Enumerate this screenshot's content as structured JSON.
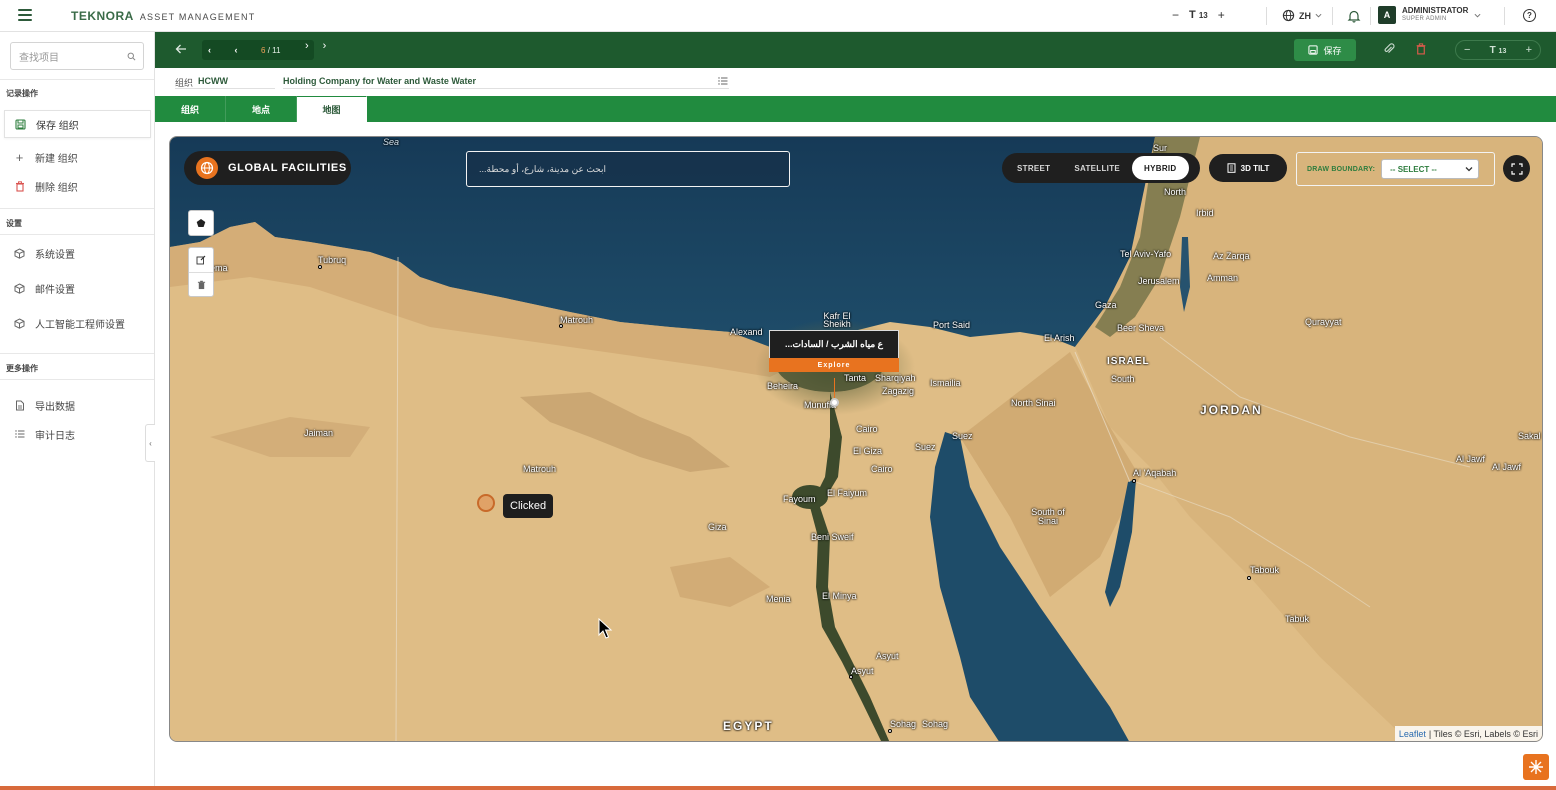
{
  "app": {
    "brand_name": "TEKNORA",
    "brand_sub": "ASSET MANAGEMENT"
  },
  "topbar": {
    "font_minus": "−",
    "font_size_label": "T",
    "font_size_value": "13",
    "font_plus": "+",
    "language": "ZH",
    "user_initial": "A",
    "user_name": "ADMINISTRATOR",
    "user_role": "SUPER ADMIN",
    "help": "?"
  },
  "sidebar": {
    "search_placeholder": "查找项目",
    "section_record": "记录操作",
    "save_org": "保存 组织",
    "new_org": "新建 组织",
    "delete_org": "删除 组织",
    "section_settings": "设置",
    "system_settings": "系统设置",
    "mail_settings": "邮件设置",
    "ai_settings": "人工智能工程师设置",
    "section_more": "更多操作",
    "export_data": "导出数据",
    "audit_log": "审计日志"
  },
  "toolbar": {
    "pager_current": "6",
    "pager_total": "/ 11",
    "save_label": "保存",
    "zoom_minus": "−",
    "zoom_t": "T",
    "zoom_value": "13",
    "zoom_plus": "+"
  },
  "org": {
    "label": "组织",
    "code": "HCWW",
    "name": "Holding Company for Water and Waste Water"
  },
  "tabs": [
    {
      "label": "组织"
    },
    {
      "label": "地点"
    },
    {
      "label": "地图"
    }
  ],
  "map": {
    "title": "GLOBAL FACILITIES",
    "search_placeholder": "...ابحث عن مدينة، شارع، أو محطة",
    "layers": [
      "STREET",
      "SATELLITE",
      "HYBRID"
    ],
    "active_layer": "HYBRID",
    "tilt_label": "3D TILT",
    "draw_label": "DRAW BOUNDARY:",
    "draw_select": "-- SELECT --",
    "popup_title": "...ع مياه الشرب / السادات",
    "popup_button": "Explore",
    "clicked_tooltip": "Clicked",
    "attribution_leaflet": "Leaflet",
    "attribution_rest": "| Tiles © Esri, Labels © Esri",
    "labels": {
      "sea": "Sea",
      "sur": "Sur",
      "north": "North",
      "irbid": "Irbid",
      "ema": "ema",
      "tubruq": "Tubruq",
      "telaviv": "Tel Aviv-Yafo",
      "azzarqa": "Az Zarqa",
      "jerusalem": "Jerusalem",
      "amman": "Amman",
      "matrouh1": "Matrouh",
      "kafr": "Kafr El Sheikh",
      "alexand": "Alexand",
      "portsaid": "Port Said",
      "gaza": "Gaza",
      "beersheva": "Beer Sheva",
      "qurayyat": "Qurayyat",
      "elarish": "El Arish",
      "israel": "ISRAEL",
      "south": "South",
      "beheira": "Beheira",
      "tanta": "Tanta",
      "menoufia": "Munufia",
      "zagazig": "Zagazig",
      "ismailia": "Ismailia",
      "sharqiyah": "Sharqiyah",
      "northsinai": "North Sinai",
      "jordan": "JORDAN",
      "jaiman": "Jaiman",
      "cairo": "Cairo",
      "elgiza": "El Giza",
      "suez": "Suez",
      "cairo2": "Cairo",
      "sakaka": "Sakal",
      "aljawf1": "Al Jawf",
      "aljawf2": "Al Jawf",
      "matrouh2": "Matrouh",
      "aqaba": "Al 'Aqabah",
      "elfaiyum": "El Faiyum",
      "fayoum": "Fayoum",
      "southsinai": "South of Sinai",
      "giza": "Giza",
      "benisweif": "Beni Sweif",
      "tabouk1": "Tabouk",
      "tabouk2": "Tabuk",
      "menia": "Menia",
      "elminya": "El Minya",
      "asyut1": "Asyut",
      "asyut2": "Asyut",
      "egypt": "EGYPT",
      "sohag1": "Sohag",
      "sohag2": "Sohag"
    }
  },
  "colors": {
    "primary_green": "#1e5a2e",
    "tab_green": "#218b3f",
    "accent_orange": "#e8731f"
  }
}
